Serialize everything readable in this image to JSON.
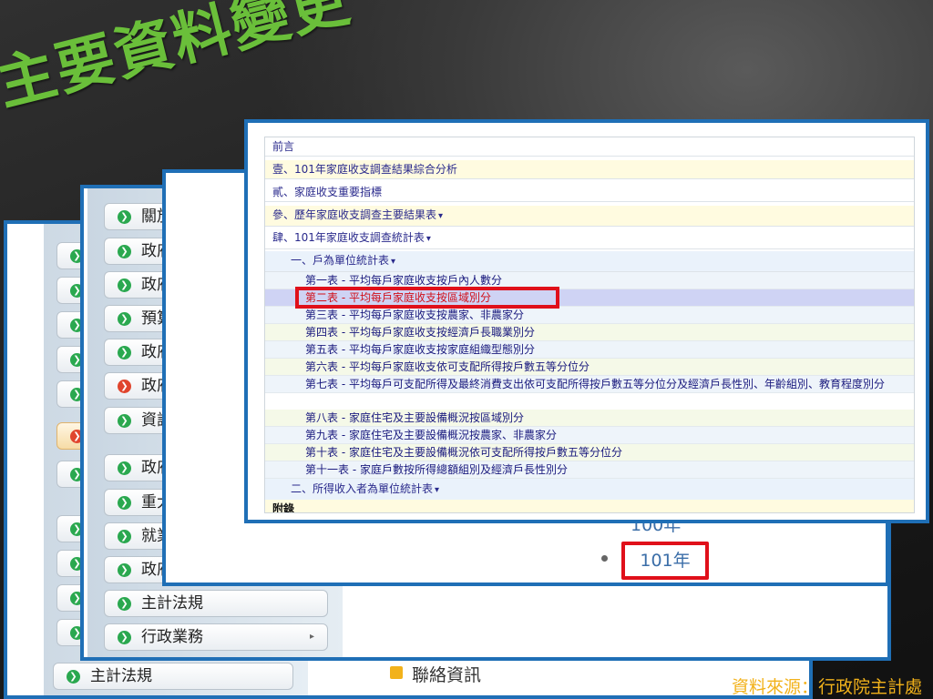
{
  "slide": {
    "title": "主要資料變更",
    "source": "資料來源：行政院主計處",
    "colors": {
      "title": "#6abf3a",
      "frame": "#1f6fb6",
      "highlight": "#e0101a",
      "source": "#f2b21b"
    }
  },
  "back_window_1": {
    "bottom_item": "主計法規",
    "contact_label": "聯絡資訊"
  },
  "back_window_2": {
    "menu": [
      {
        "label": "關放",
        "icon": "arrow-circle-icon"
      },
      {
        "label": "政府",
        "icon": "arrow-circle-icon"
      },
      {
        "label": "政府",
        "icon": "arrow-circle-icon"
      },
      {
        "label": "預算",
        "icon": "arrow-circle-icon"
      },
      {
        "label": "政府",
        "icon": "arrow-circle-icon"
      },
      {
        "label": "政府",
        "icon": "arrow-circle-icon-red"
      },
      {
        "label": "資訊",
        "icon": "arrow-circle-icon"
      },
      {
        "label": "政府",
        "icon": "arrow-circle-icon"
      },
      {
        "label": "重大",
        "icon": "arrow-circle-icon"
      },
      {
        "label": "就業",
        "icon": "arrow-circle-icon"
      },
      {
        "label": "政府",
        "icon": "arrow-circle-icon"
      },
      {
        "label": "主計法規",
        "icon": "arrow-circle-icon"
      },
      {
        "label": "行政業務",
        "icon": "arrow-circle-icon"
      }
    ],
    "caret": "▸"
  },
  "back_window_3": {
    "year_prev": "100年",
    "year_selected": "101年"
  },
  "front_window": {
    "toc": [
      {
        "label": "前言"
      },
      {
        "label": "壹、101年家庭收支調查結果綜合分析"
      },
      {
        "label": "貳、家庭收支重要指標"
      },
      {
        "label": "參、歷年家庭收支調查主要結果表",
        "expand": "▾"
      },
      {
        "label": "肆、101年家庭收支調查統計表",
        "expand": "▾"
      },
      {
        "label": "一、戶為單位統計表",
        "expand": "▾"
      },
      {
        "label": "第一表 - 平均每戶家庭收支按戶內人數分"
      },
      {
        "label": "第二表 - 平均每戶家庭收支按區域別分"
      },
      {
        "label": "第三表 - 平均每戶家庭收支按農家、非農家分"
      },
      {
        "label": "第四表 - 平均每戶家庭收支按經濟戶長職業別分"
      },
      {
        "label": "第五表 - 平均每戶家庭收支按家庭組織型態別分"
      },
      {
        "label": "第六表 - 平均每戶家庭收支依可支配所得按戶數五等分位分"
      },
      {
        "label": "第七表 - 平均每戶可支配所得及最終消費支出依可支配所得按戶數五等分位分及經濟戶長性別、年齡組別、教育程度別分"
      },
      {
        "label": "第八表 - 家庭住宅及主要設備概況按區域別分"
      },
      {
        "label": "第九表 - 家庭住宅及主要設備概況按農家、非農家分"
      },
      {
        "label": "第十表 - 家庭住宅及主要設備概況依可支配所得按戶數五等分位分"
      },
      {
        "label": "第十一表 - 家庭戶數按所得總額組別及經濟戶長性別分"
      },
      {
        "label": "二、所得收入者為單位統計表",
        "expand": "▾"
      },
      {
        "label": "附錄"
      }
    ]
  }
}
